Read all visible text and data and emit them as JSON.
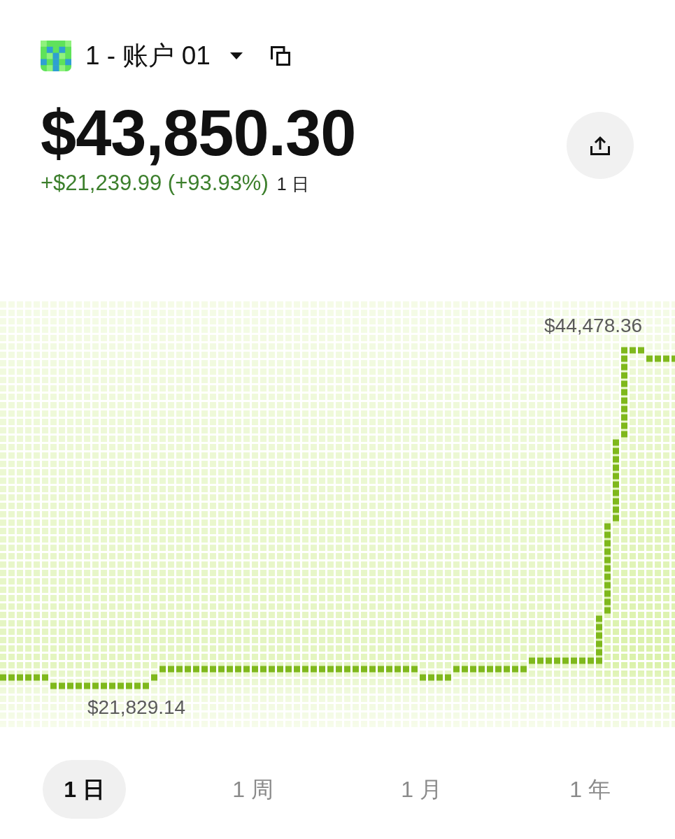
{
  "header": {
    "account": "1 - 账户 01",
    "balance": "$43,850.30",
    "gain": true,
    "change": "+$21,239.99 (+93.93%)",
    "change_period": "1 日"
  },
  "chart": {
    "high_label": "$44,478.36",
    "low_label": "$21,829.14"
  },
  "periods": [
    {
      "label": "1 日",
      "selected": true
    },
    {
      "label": "1 周",
      "selected": false
    },
    {
      "label": "1 月",
      "selected": false
    },
    {
      "label": "1 年",
      "selected": false
    }
  ]
}
